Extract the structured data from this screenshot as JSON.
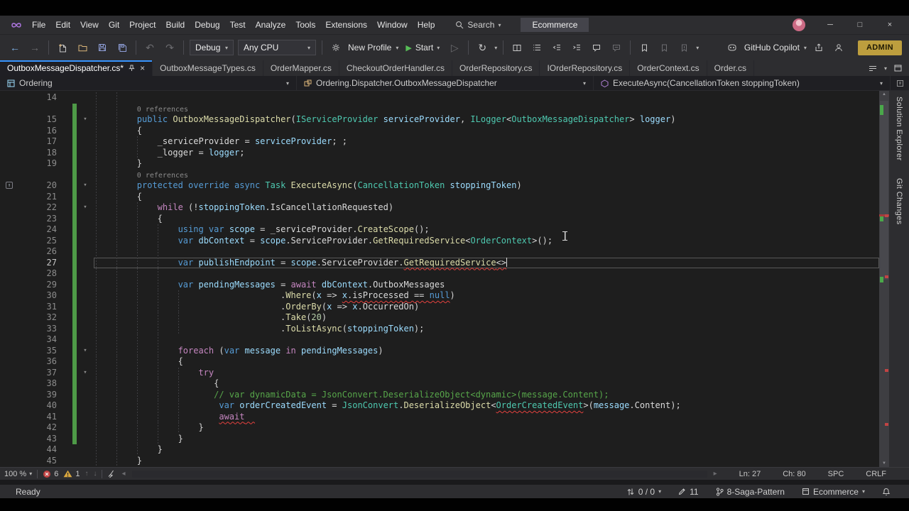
{
  "window": {
    "menu": [
      "File",
      "Edit",
      "View",
      "Git",
      "Project",
      "Build",
      "Debug",
      "Test",
      "Analyze",
      "Tools",
      "Extensions",
      "Window",
      "Help"
    ],
    "search": "Search",
    "solution": "Ecommerce",
    "copilot": "GitHub Copilot",
    "admin": "ADMIN"
  },
  "toolbar": {
    "config": "Debug",
    "platform": "Any CPU",
    "profile": "New Profile",
    "start": "Start"
  },
  "tabs": {
    "active": "OutboxMessageDispatcher.cs*",
    "others": [
      "OutboxMessageTypes.cs",
      "OrderMapper.cs",
      "CheckoutOrderHandler.cs",
      "OrderRepository.cs",
      "IOrderRepository.cs",
      "OrderContext.cs",
      "Order.cs"
    ]
  },
  "navbar": {
    "project": "Ordering",
    "type": "Ordering.Dispatcher.OutboxMessageDispatcher",
    "member": "ExecuteAsync(CancellationToken stoppingToken)"
  },
  "editor": {
    "side_tabs": [
      "Solution Explorer",
      "Git Changes"
    ],
    "rows": [
      {
        "n": 14,
        "i": 8
      },
      {
        "lens": "0 references",
        "i": 8,
        "g": 1
      },
      {
        "n": 15,
        "i": 8,
        "f": 1,
        "g": 1,
        "tk": [
          [
            "k",
            "public "
          ],
          [
            "m",
            "OutboxMessageDispatcher"
          ],
          [
            "o",
            "("
          ],
          [
            "t",
            "IServiceProvider"
          ],
          [
            "o",
            " "
          ],
          [
            "v",
            "serviceProvider"
          ],
          [
            "o",
            ", "
          ],
          [
            "t",
            "ILogger"
          ],
          [
            "o",
            "<"
          ],
          [
            "t",
            "OutboxMessageDispatcher"
          ],
          [
            "o",
            "> "
          ],
          [
            "v",
            "logger"
          ],
          [
            "o",
            ")"
          ]
        ]
      },
      {
        "n": 16,
        "i": 8,
        "g": 1,
        "tk": [
          [
            "o",
            "{"
          ]
        ]
      },
      {
        "n": 17,
        "i": 12,
        "g": 1,
        "tk": [
          [
            "p",
            "_serviceProvider"
          ],
          [
            "o",
            " = "
          ],
          [
            "v",
            "serviceProvider"
          ],
          [
            "o",
            "; ;"
          ]
        ]
      },
      {
        "n": 18,
        "i": 12,
        "g": 1,
        "tk": [
          [
            "p",
            "_logger"
          ],
          [
            "o",
            " = "
          ],
          [
            "v",
            "logger"
          ],
          [
            "o",
            ";"
          ]
        ]
      },
      {
        "n": 19,
        "i": 8,
        "g": 1,
        "tk": [
          [
            "o",
            "}"
          ]
        ]
      },
      {
        "lens": "0 references",
        "i": 8,
        "g": 1
      },
      {
        "n": 20,
        "i": 8,
        "f": 1,
        "g": 1,
        "glyph": 1,
        "tk": [
          [
            "k",
            "protected override async "
          ],
          [
            "t",
            "Task"
          ],
          [
            "o",
            " "
          ],
          [
            "m",
            "ExecuteAsync"
          ],
          [
            "o",
            "("
          ],
          [
            "t",
            "CancellationToken"
          ],
          [
            "o",
            " "
          ],
          [
            "v",
            "stoppingToken"
          ],
          [
            "o",
            ")"
          ]
        ]
      },
      {
        "n": 21,
        "i": 8,
        "g": 1,
        "tk": [
          [
            "o",
            "{"
          ]
        ]
      },
      {
        "n": 22,
        "i": 12,
        "f": 1,
        "g": 1,
        "tk": [
          [
            "c",
            "while"
          ],
          [
            "o",
            " (!"
          ],
          [
            "v",
            "stoppingToken"
          ],
          [
            "o",
            "."
          ],
          [
            "p",
            "IsCancellationRequested"
          ],
          [
            "o",
            ")"
          ]
        ]
      },
      {
        "n": 23,
        "i": 12,
        "g": 1,
        "tk": [
          [
            "o",
            "{"
          ]
        ]
      },
      {
        "n": 24,
        "i": 16,
        "g": 1,
        "tk": [
          [
            "k",
            "using var "
          ],
          [
            "v",
            "scope"
          ],
          [
            "o",
            " = "
          ],
          [
            "p",
            "_serviceProvider"
          ],
          [
            "o",
            "."
          ],
          [
            "m",
            "CreateScope"
          ],
          [
            "o",
            "();"
          ]
        ]
      },
      {
        "n": 25,
        "i": 16,
        "g": 1,
        "tk": [
          [
            "k",
            "var "
          ],
          [
            "v",
            "dbContext"
          ],
          [
            "o",
            " = "
          ],
          [
            "v",
            "scope"
          ],
          [
            "o",
            "."
          ],
          [
            "p",
            "ServiceProvider"
          ],
          [
            "o",
            "."
          ],
          [
            "m",
            "GetRequiredService"
          ],
          [
            "o",
            "<"
          ],
          [
            "t",
            "OrderContext"
          ],
          [
            "o",
            ">();"
          ]
        ]
      },
      {
        "n": 26,
        "i": 16,
        "g": 1
      },
      {
        "n": 27,
        "i": 16,
        "g": 1,
        "cur": 1,
        "caret": 1,
        "tk": [
          [
            "k",
            "var "
          ],
          [
            "v",
            "publishEndpoint"
          ],
          [
            "o",
            " = "
          ],
          [
            "v",
            "scope"
          ],
          [
            "o",
            "."
          ],
          [
            "p",
            "ServiceProvider"
          ],
          [
            "o",
            "."
          ],
          [
            "m",
            "GetRequiredService",
            1
          ],
          [
            "o",
            "<>",
            1
          ]
        ]
      },
      {
        "n": 28,
        "i": 16,
        "g": 1
      },
      {
        "n": 29,
        "i": 16,
        "g": 1,
        "tk": [
          [
            "k",
            "var "
          ],
          [
            "v",
            "pendingMessages"
          ],
          [
            "o",
            " = "
          ],
          [
            "c",
            "await"
          ],
          [
            "o",
            " "
          ],
          [
            "v",
            "dbContext"
          ],
          [
            "o",
            "."
          ],
          [
            "p",
            "OutboxMessages"
          ]
        ]
      },
      {
        "n": 30,
        "i": 36,
        "g": 1,
        "tk": [
          [
            "o",
            "."
          ],
          [
            "m",
            "Where"
          ],
          [
            "o",
            "("
          ],
          [
            "v",
            "x"
          ],
          [
            "o",
            " => "
          ],
          [
            "v",
            "x",
            1
          ],
          [
            "o",
            ".",
            1
          ],
          [
            "p",
            "isProcessed",
            1
          ],
          [
            "o",
            " == ",
            1
          ],
          [
            "k",
            "null",
            1
          ],
          [
            "o",
            ")"
          ]
        ]
      },
      {
        "n": 31,
        "i": 36,
        "g": 1,
        "tk": [
          [
            "o",
            "."
          ],
          [
            "m",
            "OrderBy"
          ],
          [
            "o",
            "("
          ],
          [
            "v",
            "x"
          ],
          [
            "o",
            " => "
          ],
          [
            "v",
            "x"
          ],
          [
            "o",
            "."
          ],
          [
            "p",
            "OccurredOn"
          ],
          [
            "o",
            ")"
          ]
        ]
      },
      {
        "n": 32,
        "i": 36,
        "g": 1,
        "tk": [
          [
            "o",
            "."
          ],
          [
            "m",
            "Take"
          ],
          [
            "o",
            "("
          ],
          [
            "num",
            "20"
          ],
          [
            "o",
            ")"
          ]
        ]
      },
      {
        "n": 33,
        "i": 36,
        "g": 1,
        "tk": [
          [
            "o",
            "."
          ],
          [
            "m",
            "ToListAsync"
          ],
          [
            "o",
            "("
          ],
          [
            "v",
            "stoppingToken"
          ],
          [
            "o",
            ");"
          ]
        ]
      },
      {
        "n": 34,
        "i": 16,
        "g": 1
      },
      {
        "n": 35,
        "i": 16,
        "f": 1,
        "g": 1,
        "tk": [
          [
            "c",
            "foreach"
          ],
          [
            "o",
            " ("
          ],
          [
            "k",
            "var "
          ],
          [
            "v",
            "message"
          ],
          [
            "o",
            " "
          ],
          [
            "c",
            "in"
          ],
          [
            "o",
            " "
          ],
          [
            "v",
            "pendingMessages"
          ],
          [
            "o",
            ")"
          ]
        ]
      },
      {
        "n": 36,
        "i": 16,
        "g": 1,
        "tk": [
          [
            "o",
            "{"
          ]
        ]
      },
      {
        "n": 37,
        "i": 20,
        "f": 1,
        "g": 1,
        "tk": [
          [
            "c",
            "try"
          ]
        ]
      },
      {
        "n": 38,
        "i": 23,
        "g": 1,
        "tk": [
          [
            "o",
            "{"
          ]
        ]
      },
      {
        "n": 39,
        "i": 23,
        "g": 1,
        "tk": [
          [
            "cm",
            "// var dynamicData = JsonConvert.DeserializeObject<dynamic>(message.Content);"
          ]
        ]
      },
      {
        "n": 40,
        "i": 24,
        "g": 1,
        "tk": [
          [
            "k",
            "var "
          ],
          [
            "v",
            "orderCreatedEvent"
          ],
          [
            "o",
            " = "
          ],
          [
            "t",
            "JsonConvert"
          ],
          [
            "o",
            "."
          ],
          [
            "m",
            "DeserializeObject"
          ],
          [
            "o",
            "<"
          ],
          [
            "t",
            "OrderCreatedEvent",
            1
          ],
          [
            "o",
            ">("
          ],
          [
            "v",
            "message"
          ],
          [
            "o",
            "."
          ],
          [
            "p",
            "Content"
          ],
          [
            "o",
            ");"
          ]
        ]
      },
      {
        "n": 41,
        "i": 24,
        "g": 1,
        "tk": [
          [
            "c",
            "await",
            1
          ],
          [
            "o",
            "  ",
            1
          ]
        ]
      },
      {
        "n": 42,
        "i": 20,
        "g": 1,
        "tk": [
          [
            "o",
            "}"
          ]
        ]
      },
      {
        "n": 43,
        "i": 16,
        "g": 1,
        "tk": [
          [
            "o",
            "}"
          ]
        ]
      },
      {
        "n": 44,
        "i": 12,
        "tk": [
          [
            "o",
            "}"
          ]
        ]
      },
      {
        "n": 45,
        "i": 8,
        "tk": [
          [
            "o",
            "}"
          ]
        ]
      }
    ]
  },
  "editor_status": {
    "zoom": "100 %",
    "errors": "6",
    "warnings": "1",
    "line": "Ln: 27",
    "col": "Ch: 80",
    "spaces": "SPC",
    "eol": "CRLF"
  },
  "status_bar": {
    "message": "Ready",
    "sync": "0 / 0",
    "pending_changes": "11",
    "branch": "8-Saga-Pattern",
    "repo": "Ecommerce"
  },
  "colors": {
    "accent": "#3794FF",
    "error": "#E5413E",
    "warning": "#D9A73E",
    "change_bar": "#4E9A47",
    "admin_badge": "#BD9E3E"
  }
}
